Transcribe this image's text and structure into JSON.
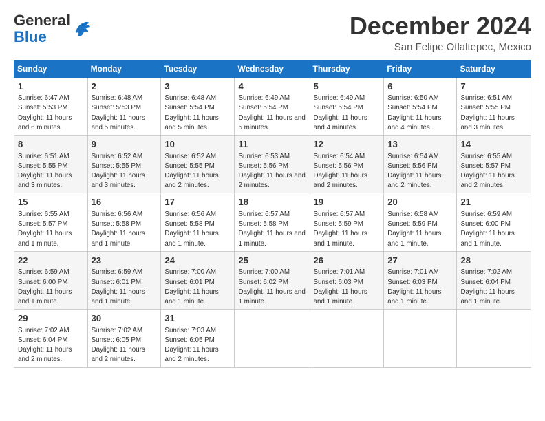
{
  "logo": {
    "line1": "General",
    "line2": "Blue"
  },
  "header": {
    "month": "December 2024",
    "location": "San Felipe Otlaltepec, Mexico"
  },
  "weekdays": [
    "Sunday",
    "Monday",
    "Tuesday",
    "Wednesday",
    "Thursday",
    "Friday",
    "Saturday"
  ],
  "weeks": [
    [
      {
        "day": "1",
        "rise": "6:47 AM",
        "set": "5:53 PM",
        "daylight": "11 hours and 6 minutes."
      },
      {
        "day": "2",
        "rise": "6:48 AM",
        "set": "5:53 PM",
        "daylight": "11 hours and 5 minutes."
      },
      {
        "day": "3",
        "rise": "6:48 AM",
        "set": "5:54 PM",
        "daylight": "11 hours and 5 minutes."
      },
      {
        "day": "4",
        "rise": "6:49 AM",
        "set": "5:54 PM",
        "daylight": "11 hours and 5 minutes."
      },
      {
        "day": "5",
        "rise": "6:49 AM",
        "set": "5:54 PM",
        "daylight": "11 hours and 4 minutes."
      },
      {
        "day": "6",
        "rise": "6:50 AM",
        "set": "5:54 PM",
        "daylight": "11 hours and 4 minutes."
      },
      {
        "day": "7",
        "rise": "6:51 AM",
        "set": "5:55 PM",
        "daylight": "11 hours and 3 minutes."
      }
    ],
    [
      {
        "day": "8",
        "rise": "6:51 AM",
        "set": "5:55 PM",
        "daylight": "11 hours and 3 minutes."
      },
      {
        "day": "9",
        "rise": "6:52 AM",
        "set": "5:55 PM",
        "daylight": "11 hours and 3 minutes."
      },
      {
        "day": "10",
        "rise": "6:52 AM",
        "set": "5:55 PM",
        "daylight": "11 hours and 2 minutes."
      },
      {
        "day": "11",
        "rise": "6:53 AM",
        "set": "5:56 PM",
        "daylight": "11 hours and 2 minutes."
      },
      {
        "day": "12",
        "rise": "6:54 AM",
        "set": "5:56 PM",
        "daylight": "11 hours and 2 minutes."
      },
      {
        "day": "13",
        "rise": "6:54 AM",
        "set": "5:56 PM",
        "daylight": "11 hours and 2 minutes."
      },
      {
        "day": "14",
        "rise": "6:55 AM",
        "set": "5:57 PM",
        "daylight": "11 hours and 2 minutes."
      }
    ],
    [
      {
        "day": "15",
        "rise": "6:55 AM",
        "set": "5:57 PM",
        "daylight": "11 hours and 1 minute."
      },
      {
        "day": "16",
        "rise": "6:56 AM",
        "set": "5:58 PM",
        "daylight": "11 hours and 1 minute."
      },
      {
        "day": "17",
        "rise": "6:56 AM",
        "set": "5:58 PM",
        "daylight": "11 hours and 1 minute."
      },
      {
        "day": "18",
        "rise": "6:57 AM",
        "set": "5:58 PM",
        "daylight": "11 hours and 1 minute."
      },
      {
        "day": "19",
        "rise": "6:57 AM",
        "set": "5:59 PM",
        "daylight": "11 hours and 1 minute."
      },
      {
        "day": "20",
        "rise": "6:58 AM",
        "set": "5:59 PM",
        "daylight": "11 hours and 1 minute."
      },
      {
        "day": "21",
        "rise": "6:59 AM",
        "set": "6:00 PM",
        "daylight": "11 hours and 1 minute."
      }
    ],
    [
      {
        "day": "22",
        "rise": "6:59 AM",
        "set": "6:00 PM",
        "daylight": "11 hours and 1 minute."
      },
      {
        "day": "23",
        "rise": "6:59 AM",
        "set": "6:01 PM",
        "daylight": "11 hours and 1 minute."
      },
      {
        "day": "24",
        "rise": "7:00 AM",
        "set": "6:01 PM",
        "daylight": "11 hours and 1 minute."
      },
      {
        "day": "25",
        "rise": "7:00 AM",
        "set": "6:02 PM",
        "daylight": "11 hours and 1 minute."
      },
      {
        "day": "26",
        "rise": "7:01 AM",
        "set": "6:03 PM",
        "daylight": "11 hours and 1 minute."
      },
      {
        "day": "27",
        "rise": "7:01 AM",
        "set": "6:03 PM",
        "daylight": "11 hours and 1 minute."
      },
      {
        "day": "28",
        "rise": "7:02 AM",
        "set": "6:04 PM",
        "daylight": "11 hours and 1 minute."
      }
    ],
    [
      {
        "day": "29",
        "rise": "7:02 AM",
        "set": "6:04 PM",
        "daylight": "11 hours and 2 minutes."
      },
      {
        "day": "30",
        "rise": "7:02 AM",
        "set": "6:05 PM",
        "daylight": "11 hours and 2 minutes."
      },
      {
        "day": "31",
        "rise": "7:03 AM",
        "set": "6:05 PM",
        "daylight": "11 hours and 2 minutes."
      },
      null,
      null,
      null,
      null
    ]
  ],
  "labels": {
    "sunrise": "Sunrise:",
    "sunset": "Sunset:",
    "daylight": "Daylight:"
  }
}
